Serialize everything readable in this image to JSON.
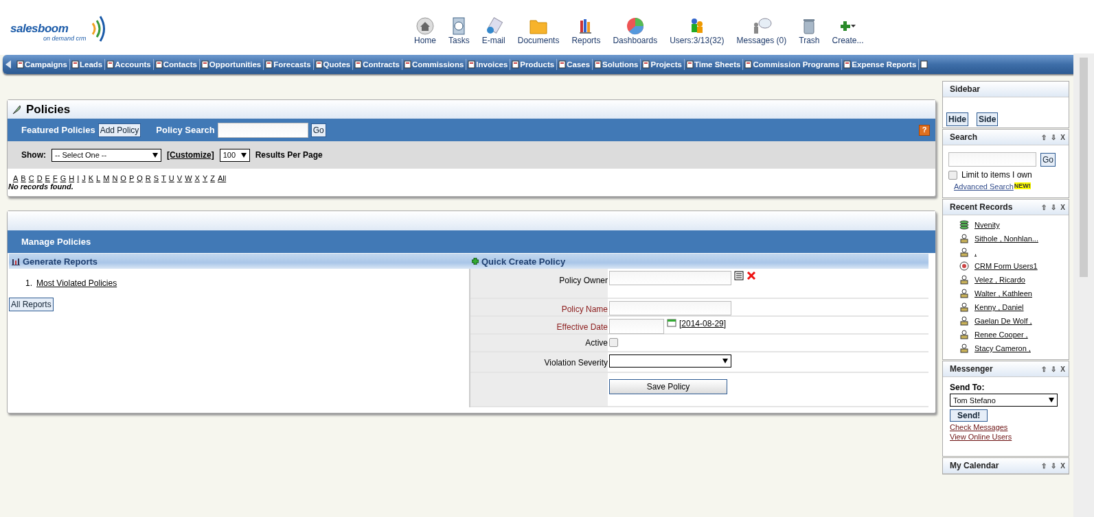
{
  "logo": {
    "name": "salesboom",
    "tagline": "on demand crm"
  },
  "top_nav": [
    {
      "label": "Home",
      "kind": "home"
    },
    {
      "label": "Tasks",
      "kind": "tasks"
    },
    {
      "label": "E-mail",
      "kind": "email"
    },
    {
      "label": "Documents",
      "kind": "documents"
    },
    {
      "label": "Reports",
      "kind": "reports"
    },
    {
      "label": "Dashboards",
      "kind": "dashboards"
    },
    {
      "label": "Users:3/13(32)",
      "kind": "users"
    },
    {
      "label": "Messages (0)",
      "kind": "messages"
    },
    {
      "label": "Trash",
      "kind": "trash"
    },
    {
      "label": "Create...",
      "kind": "create"
    }
  ],
  "tabs": [
    "Campaigns",
    "Leads",
    "Accounts",
    "Contacts",
    "Opportunities",
    "Forecasts",
    "Quotes",
    "Contracts",
    "Commissions",
    "Invoices",
    "Products",
    "Cases",
    "Solutions",
    "Projects",
    "Time Sheets",
    "Commission Programs",
    "Expense Reports"
  ],
  "policies": {
    "title": "Policies",
    "featured": "Featured Policies",
    "add_button": "Add Policy",
    "search_label": "Policy Search",
    "go": "Go",
    "help": "?",
    "show_label": "Show:",
    "show_value": "-- Select One --",
    "customize": "[Customize]",
    "per_page": "100",
    "per_page_label": "Results Per Page",
    "letters": [
      "A",
      "B",
      "C",
      "D",
      "E",
      "F",
      "G",
      "H",
      "I",
      "J",
      "K",
      "L",
      "M",
      "N",
      "O",
      "P",
      "Q",
      "R",
      "S",
      "T",
      "U",
      "V",
      "W",
      "X",
      "Y",
      "Z",
      "All"
    ],
    "empty": "No records found."
  },
  "manage": {
    "title": "Manage Policies",
    "reports_title": "Generate Reports",
    "reports": [
      {
        "number": "1.",
        "label": "Most Violated Policies"
      }
    ],
    "all_reports": "All Reports",
    "create_title": "Quick Create Policy",
    "fields": [
      {
        "label": "Policy Owner",
        "kind": "lookup",
        "required": false
      },
      {
        "label": "Policy Name",
        "kind": "text",
        "required": true
      },
      {
        "label": "Effective Date",
        "kind": "date",
        "required": true,
        "today_open": "[",
        "today": "2014-08-29",
        "today_close": "]"
      },
      {
        "label": "Active",
        "kind": "checkbox",
        "required": false,
        "checked": false
      },
      {
        "label": "Violation Severity",
        "kind": "select",
        "required": false
      }
    ],
    "save": "Save Policy"
  },
  "sidebar": {
    "title": "Sidebar",
    "buttons": [
      "Hide",
      "Side"
    ],
    "search": {
      "title": "Search",
      "controls": [
        "⇧",
        "⇩",
        "X"
      ],
      "go": "Go",
      "limit": "Limit to items I own",
      "limit_checked": false,
      "advanced": "Advanced Search",
      "new_badge": "NEW!"
    },
    "recent": {
      "title": "Recent Records",
      "controls": [
        "⇧",
        "⇩",
        "X"
      ],
      "items": [
        {
          "label": "Nvenity",
          "kind": "account"
        },
        {
          "label": " Sithole , Nonhlan...",
          "kind": "contact"
        },
        {
          "label": ",",
          "kind": "contact"
        },
        {
          "label": "CRM Form Users1",
          "kind": "campaign"
        },
        {
          "label": " Velez , Ricardo",
          "kind": "contact"
        },
        {
          "label": " Walter , Kathleen",
          "kind": "contact"
        },
        {
          "label": " Kenny , Daniel",
          "kind": "contact"
        },
        {
          "label": " Gaelan De Wolf ,",
          "kind": "contact"
        },
        {
          "label": " Renee Cooper ,",
          "kind": "contact"
        },
        {
          "label": " Stacy Cameron ,",
          "kind": "contact"
        }
      ]
    },
    "messenger": {
      "title": "Messenger",
      "controls": [
        "⇧",
        "⇩",
        "X"
      ],
      "send_to": "Send To:",
      "recipient": "Tom Stefano",
      "send": "Send!",
      "links": [
        "Check Messages",
        "View Online Users"
      ]
    },
    "calendar": {
      "title": "My Calendar",
      "controls": [
        "⇧",
        "⇩",
        "X"
      ]
    }
  }
}
